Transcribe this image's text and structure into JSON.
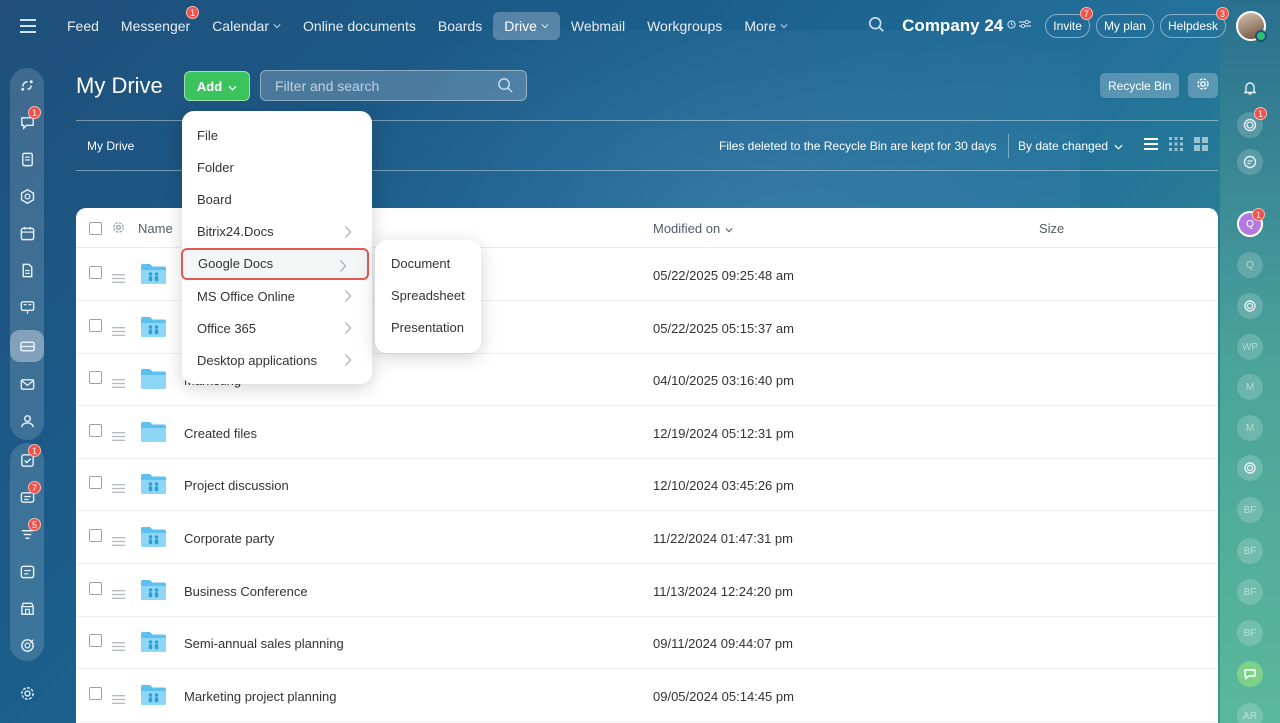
{
  "topnav": {
    "items": [
      {
        "label": "Feed",
        "badge": ""
      },
      {
        "label": "Messenger",
        "badge": "1"
      },
      {
        "label": "Calendar",
        "badge": "",
        "dropdown": true
      },
      {
        "label": "Online documents",
        "badge": ""
      },
      {
        "label": "Boards",
        "badge": ""
      },
      {
        "label": "Drive",
        "badge": "",
        "dropdown": true,
        "active": true
      },
      {
        "label": "Webmail",
        "badge": ""
      },
      {
        "label": "Workgroups",
        "badge": ""
      },
      {
        "label": "More",
        "badge": "",
        "dropdown": true
      }
    ],
    "company": "Company 24",
    "invite_label": "Invite",
    "invite_badge": "7",
    "myplan_label": "My plan",
    "helpdesk_label": "Helpdesk",
    "helpdesk_badge": "3"
  },
  "left_sidebar": {
    "badges": {
      "chat": "1",
      "tasks": "1",
      "inbox": "7",
      "sales": "5"
    }
  },
  "right_sidebar": {
    "badges": {
      "copilot": "1",
      "user_q": "1"
    },
    "avatars": [
      "Q",
      "Q",
      "WP",
      "M",
      "M",
      "BF",
      "BF",
      "BF",
      "BF",
      "AR"
    ]
  },
  "header": {
    "title": "My Drive",
    "add_label": "Add",
    "filter_placeholder": "Filter and search",
    "recycle_label": "Recycle Bin"
  },
  "subheader": {
    "breadcrumb": "My Drive",
    "retention_text": "Files deleted to the Recycle Bin are kept for 30 days",
    "sort_label": "By date changed"
  },
  "table": {
    "columns": {
      "name": "Name",
      "modified": "Modified on",
      "size": "Size"
    },
    "rows": [
      {
        "name": "",
        "modified": "05/22/2025 09:25:48 am",
        "shared": true
      },
      {
        "name": "",
        "modified": "05/22/2025 05:15:37 am",
        "shared": true
      },
      {
        "name": "Marketing",
        "modified": "04/10/2025 03:16:40 pm",
        "shared": false
      },
      {
        "name": "Created files",
        "modified": "12/19/2024 05:12:31 pm",
        "shared": false
      },
      {
        "name": "Project discussion",
        "modified": "12/10/2024 03:45:26 pm",
        "shared": true
      },
      {
        "name": "Corporate party",
        "modified": "11/22/2024 01:47:31 pm",
        "shared": true
      },
      {
        "name": "Business Conference",
        "modified": "11/13/2024 12:24:20 pm",
        "shared": true
      },
      {
        "name": "Semi-annual sales planning",
        "modified": "09/11/2024 09:44:07 pm",
        "shared": true
      },
      {
        "name": "Marketing project planning",
        "modified": "09/05/2024 05:14:45 pm",
        "shared": true
      }
    ]
  },
  "add_menu": {
    "items": [
      {
        "label": "File",
        "submenu": false
      },
      {
        "label": "Folder",
        "submenu": false
      },
      {
        "label": "Board",
        "submenu": false
      },
      {
        "label": "Bitrix24.Docs",
        "submenu": true
      },
      {
        "label": "Google Docs",
        "submenu": true,
        "highlighted": true
      },
      {
        "label": "MS Office Online",
        "submenu": true
      },
      {
        "label": "Office 365",
        "submenu": true
      },
      {
        "label": "Desktop applications",
        "submenu": true
      }
    ],
    "submenu": [
      "Document",
      "Spreadsheet",
      "Presentation"
    ]
  },
  "colors": {
    "accent_green": "#3bc35d",
    "highlight_border": "#e05c52",
    "badge_red": "#f0514a",
    "folder_blue": "#7fd0f2"
  }
}
